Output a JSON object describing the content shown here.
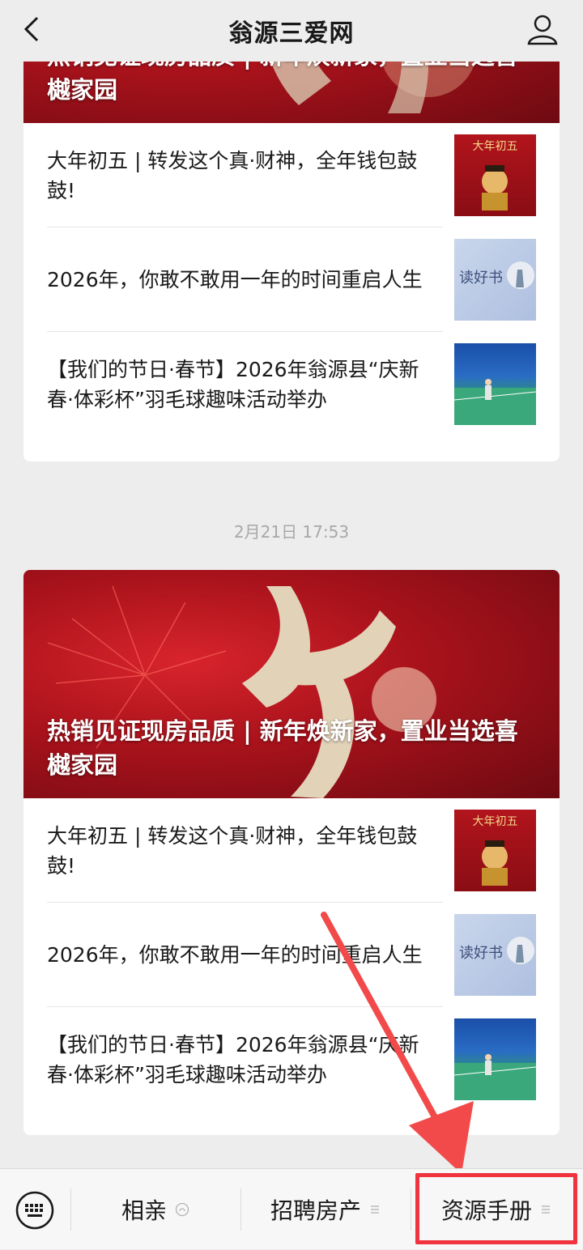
{
  "nav": {
    "title": "翁源三爱网",
    "back_icon": "chevron-left-icon",
    "profile_icon": "user-icon"
  },
  "feed": [
    {
      "hero_title": "热销见证现房品质 | 新年焕新家，置业当选喜樾家园",
      "articles": [
        {
          "title": "大年初五 | 转发这个真·财神，全年钱包鼓鼓!"
        },
        {
          "title": "2026年，你敢不敢用一年的时间重启人生"
        },
        {
          "title": "【我们的节日·春节】2026年翁源县“庆新春·体彩杯”羽毛球趣味活动举办"
        }
      ]
    },
    {
      "timestamp": "2月21日 17:53",
      "hero_title": "热销见证现房品质 | 新年焕新家，置业当选喜樾家园",
      "articles": [
        {
          "title": "大年初五 | 转发这个真·财神，全年钱包鼓鼓!"
        },
        {
          "title": "2026年，你敢不敢用一年的时间重启人生"
        },
        {
          "title": "【我们的节日·春节】2026年翁源县“庆新春·体彩杯”羽毛球趣味活动举办"
        }
      ]
    }
  ],
  "thumbs": {
    "caishen_top": "大年初五",
    "read_book": "读好书"
  },
  "bottom_menu": {
    "keyboard_icon": "keyboard-icon",
    "items": [
      {
        "label": "相亲",
        "icon": "mini-program-icon"
      },
      {
        "label": "招聘房产",
        "icon": "menu-lines-icon"
      },
      {
        "label": "资源手册",
        "icon": "menu-lines-icon"
      }
    ]
  },
  "colors": {
    "accent_red": "#f0333f",
    "hero_red": "#a8121b",
    "background": "#ededed"
  }
}
